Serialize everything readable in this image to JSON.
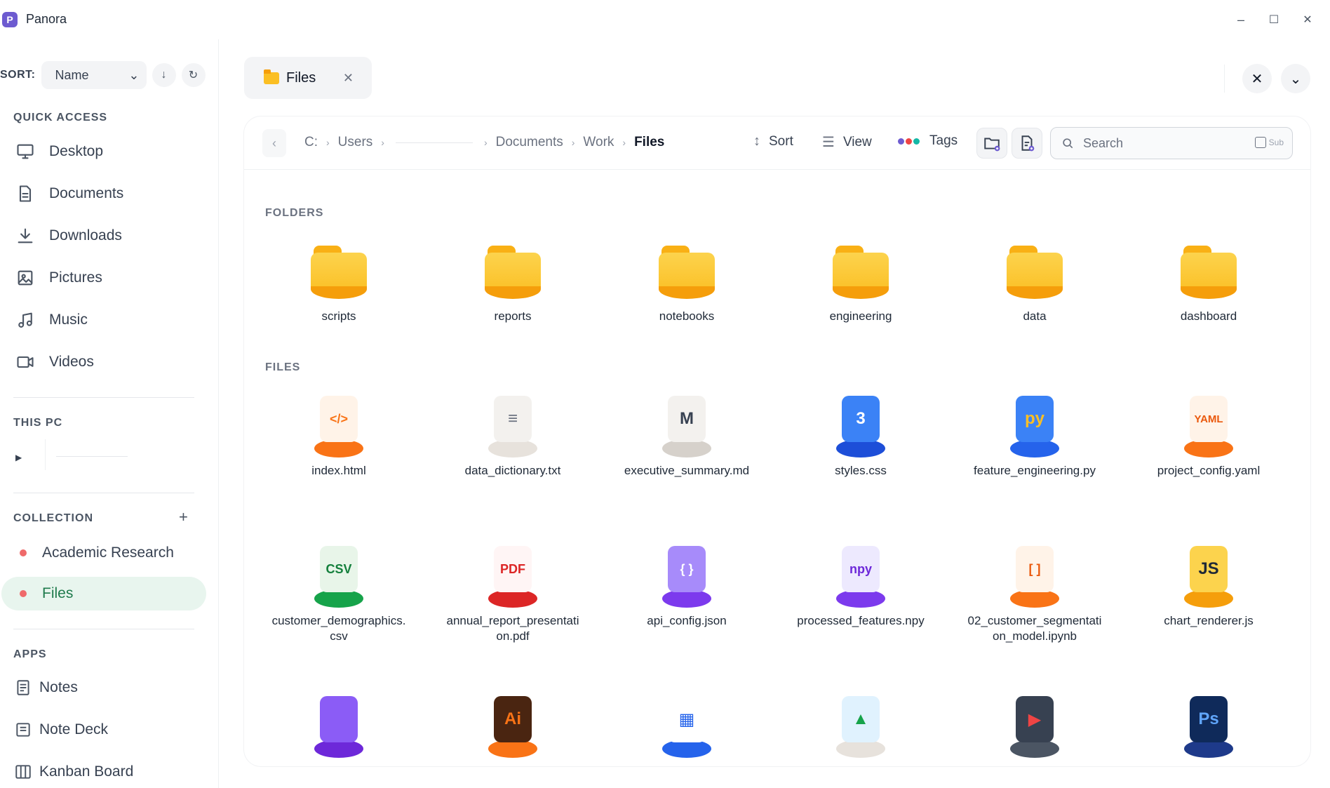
{
  "app": {
    "title": "Panora",
    "logo_letter": "P"
  },
  "window_controls": {
    "minimize": "–",
    "maximize": "☐",
    "close": "✕"
  },
  "sidebar": {
    "sort_label": "SORT:",
    "sort_value": "Name",
    "quick_access_title": "QUICK ACCESS",
    "quick_access": [
      {
        "label": "Desktop",
        "icon": "monitor-icon"
      },
      {
        "label": "Documents",
        "icon": "document-icon"
      },
      {
        "label": "Downloads",
        "icon": "download-icon"
      },
      {
        "label": "Pictures",
        "icon": "image-icon"
      },
      {
        "label": "Music",
        "icon": "music-icon"
      },
      {
        "label": "Videos",
        "icon": "video-icon"
      }
    ],
    "this_pc_title": "THIS PC",
    "collection_title": "COLLECTION",
    "collections": [
      {
        "label": "Academic Research",
        "color": "#ef6a6a"
      },
      {
        "label": "Files",
        "color": "#ef6a6a",
        "active": true
      }
    ],
    "apps_title": "APPS",
    "apps": [
      {
        "label": "Notes",
        "icon": "notes-icon"
      },
      {
        "label": "Note Deck",
        "icon": "note-deck-icon"
      },
      {
        "label": "Kanban Board",
        "icon": "kanban-icon"
      }
    ]
  },
  "tab": {
    "label": "Files"
  },
  "toolbar": {
    "breadcrumbs": [
      "C:",
      "Users",
      "Documents",
      "Work",
      "Files"
    ],
    "sort_label": "Sort",
    "view_label": "View",
    "tags_label": "Tags",
    "search_placeholder": "Search",
    "sub_label": "Sub"
  },
  "folders_title": "FOLDERS",
  "folders": [
    "scripts",
    "reports",
    "notebooks",
    "engineering",
    "data",
    "dashboard"
  ],
  "files_title": "FILES",
  "files": [
    {
      "name": "index.html",
      "badge": "</>",
      "page": "#fff3e8",
      "color": "#f97316",
      "base": "#f97316"
    },
    {
      "name": "data_dictionary.txt",
      "badge": "≡",
      "page": "#f3f1ee",
      "color": "#6b7280",
      "base": "#e7e2dc"
    },
    {
      "name": "executive_summary.md",
      "badge": "M",
      "page": "#f3f1ee",
      "color": "#374151",
      "base": "#d6d1cb"
    },
    {
      "name": "styles.css",
      "badge": "3",
      "page": "#3b82f6",
      "color": "#ffffff",
      "base": "#1d4ed8"
    },
    {
      "name": "feature_engineering.py",
      "badge": "py",
      "page": "#3b82f6",
      "color": "#fbbf24",
      "base": "#2563eb"
    },
    {
      "name": "project_config.yaml",
      "badge": "YAML",
      "page": "#fff3e8",
      "color": "#ea580c",
      "base": "#f97316"
    },
    {
      "name": "customer_demographics.csv",
      "badge": "CSV",
      "page": "#e8f5e9",
      "color": "#15803d",
      "base": "#16a34a"
    },
    {
      "name": "annual_report_presentation.pdf",
      "badge": "PDF",
      "page": "#fff5f5",
      "color": "#dc2626",
      "base": "#dc2626"
    },
    {
      "name": "api_config.json",
      "badge": "{ }",
      "page": "#a78bfa",
      "color": "#ffffff",
      "base": "#7c3aed"
    },
    {
      "name": "processed_features.npy",
      "badge": "npy",
      "page": "#ede9fe",
      "color": "#6d28d9",
      "base": "#7c3aed"
    },
    {
      "name": "02_customer_segmentation_model.ipynb",
      "badge": "[ ]",
      "page": "#fff3e8",
      "color": "#ea580c",
      "base": "#f97316"
    },
    {
      "name": "chart_renderer.js",
      "badge": "JS",
      "page": "#fcd34d",
      "color": "#1f2937",
      "base": "#f59e0b"
    },
    {
      "name": "",
      "badge": "",
      "page": "#8b5cf6",
      "color": "#ffffff",
      "base": "#6d28d9"
    },
    {
      "name": "",
      "badge": "Ai",
      "page": "#4a2511",
      "color": "#f97316",
      "base": "#f97316"
    },
    {
      "name": "",
      "badge": "▦",
      "page": "#ffffff",
      "color": "#2563eb",
      "base": "#2563eb"
    },
    {
      "name": "",
      "badge": "▲",
      "page": "#e0f2fe",
      "color": "#16a34a",
      "base": "#e7e2dc"
    },
    {
      "name": "",
      "badge": "▶",
      "page": "#374151",
      "color": "#ef4444",
      "base": "#4b5563"
    },
    {
      "name": "",
      "badge": "Ps",
      "page": "#0f2a5a",
      "color": "#60a5fa",
      "base": "#1e3a8a"
    }
  ]
}
